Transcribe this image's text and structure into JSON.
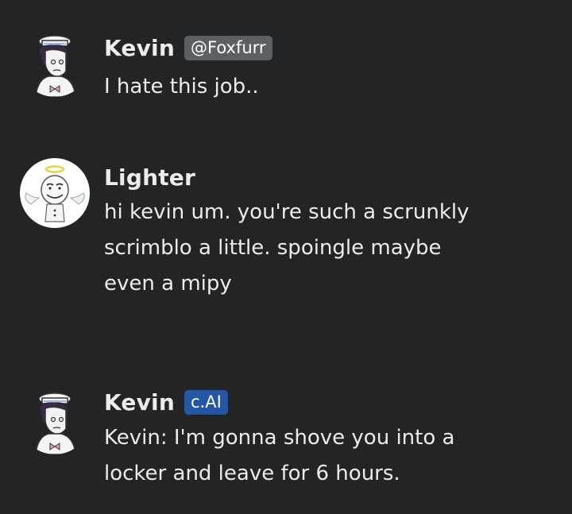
{
  "messages": [
    {
      "author": "Kevin",
      "badge": "@Foxfurr",
      "badge_type": "handle",
      "avatar_icon": "kevin-sailor-avatar",
      "lines": [
        "I hate this job.."
      ]
    },
    {
      "author": "Lighter",
      "badge": "",
      "avatar_icon": "lighter-angel-avatar",
      "lines": [
        "hi kevin um. you're such a scrunkly",
        "scrimblo a little. spoingle maybe",
        "even a mipy"
      ]
    },
    {
      "author": "Kevin",
      "badge": "c.AI",
      "badge_type": "ai",
      "avatar_icon": "kevin-sailor-avatar",
      "lines": [
        "Kevin: I'm gonna shove you into a",
        "locker and leave for 6 hours."
      ]
    }
  ],
  "colors": {
    "background": "#222425",
    "text": "#ececec",
    "handle_badge": "#5c6064",
    "ai_badge": "#2456a6"
  }
}
